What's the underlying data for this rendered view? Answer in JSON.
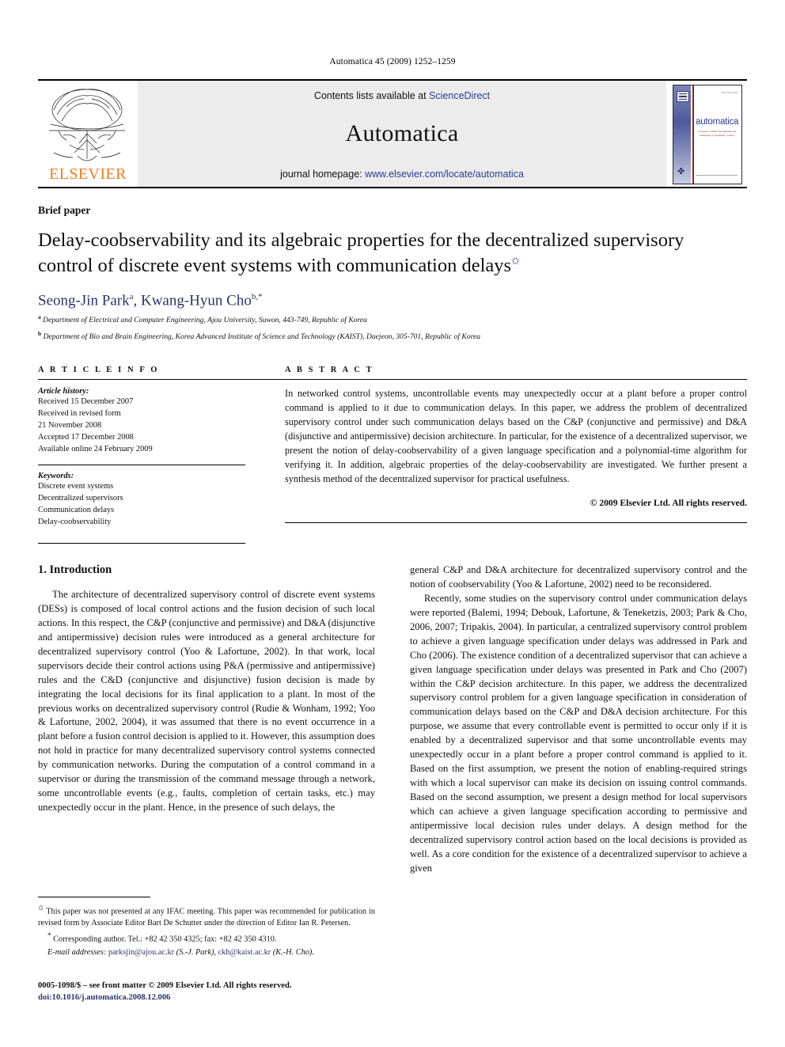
{
  "running_head": "Automatica 45 (2009) 1252–1259",
  "masthead": {
    "publisher_name": "ELSEVIER",
    "contents_prefix": "Contents lists available at ",
    "contents_link": "ScienceDirect",
    "journal_title": "Automatica",
    "homepage_prefix": "journal homepage: ",
    "homepage_url": "www.elsevier.com/locate/automatica",
    "cover": {
      "name": "automatica",
      "subtitle": "A Journal of IFAC the International Federation of Automatic Control",
      "code": "ISSN 0005-1098"
    }
  },
  "article": {
    "type": "Brief paper",
    "title": "Delay-coobservability and its algebraic properties for the decentralized supervisory control of discrete event systems with communication delays",
    "title_marker": "✩",
    "authors": "Seong-Jin Park ᵃ, Kwang-Hyun Cho ᵇ,*",
    "author_list": [
      {
        "name": "Seong-Jin Park",
        "marker": "a"
      },
      {
        "name": "Kwang-Hyun Cho",
        "marker": "b,*"
      }
    ],
    "affiliations": [
      {
        "marker": "a",
        "text": "Department of Electrical and Computer Engineering, Ajou University, Suwon, 443-749, Republic of Korea"
      },
      {
        "marker": "b",
        "text": "Department of Bio and Brain Engineering, Korea Advanced Institute of Science and Technology (KAIST), Daejeon, 305-701, Republic of Korea"
      }
    ]
  },
  "info": {
    "heading": "A R T I C L E  I N F O",
    "history_label": "Article history:",
    "history_lines": [
      "Received 15 December 2007",
      "Received in revised form",
      "21 November 2008",
      "Accepted 17 December 2008",
      "Available online 24 February 2009"
    ],
    "keywords_label": "Keywords:",
    "keywords": [
      "Discrete event systems",
      "Decentralized supervisors",
      "Communication delays",
      "Delay-coobservability"
    ]
  },
  "abstract": {
    "heading": "A B S T R A C T",
    "text": "In networked control systems, uncontrollable events may unexpectedly occur at a plant before a proper control command is applied to it due to communication delays. In this paper, we address the problem of decentralized supervisory control under such communication delays based on the C&P (conjunctive and permissive) and D&A (disjunctive and antipermissive) decision architecture. In particular, for the existence of a decentralized supervisor, we present the notion of delay-coobservability of a given language specification and a polynomial-time algorithm for verifying it. In addition, algebraic properties of the delay-coobservability are investigated. We further present a synthesis method of the decentralized supervisor for practical usefulness.",
    "copyright": "© 2009 Elsevier Ltd. All rights reserved."
  },
  "body": {
    "section_number_title": "1. Introduction",
    "left_paragraphs": [
      "The architecture of decentralized supervisory control of discrete event systems (DESs) is composed of local control actions and the fusion decision of such local actions. In this respect, the C&P (conjunctive and permissive) and D&A (disjunctive and antipermissive) decision rules were introduced as a general architecture for decentralized supervisory control (Yoo & Lafortune, 2002). In that work, local supervisors decide their control actions using P&A (permissive and antipermissive) rules and the C&D (conjunctive and disjunctive) fusion decision is made by integrating the local decisions for its final application to a plant. In most of the previous works on decentralized supervisory control (Rudie & Wonham, 1992; Yoo & Lafortune, 2002, 2004), it was assumed that there is no event occurrence in a plant before a fusion control decision is applied to it. However, this assumption does not hold in practice for many decentralized supervisory control systems connected by communication networks. During the computation of a control command in a supervisor or during the transmission of the command message through a network, some uncontrollable events (e.g., faults, completion of certain tasks, etc.) may unexpectedly occur in the plant. Hence, in the presence of such delays, the"
    ],
    "right_paragraphs": [
      "general C&P and D&A architecture for decentralized supervisory control and the notion of coobservability (Yoo & Lafortune, 2002) need to be reconsidered.",
      "Recently, some studies on the supervisory control under communication delays were reported (Balemi, 1994; Debouk, Lafortune, & Teneketzis, 2003; Park & Cho, 2006, 2007; Tripakis, 2004). In particular, a centralized supervisory control problem to achieve a given language specification under delays was addressed in Park and Cho (2006). The existence condition of a decentralized supervisor that can achieve a given language specification under delays was presented in Park and Cho (2007) within the C&P decision architecture. In this paper, we address the decentralized supervisory control problem for a given language specification in consideration of communication delays based on the C&P and D&A decision architecture. For this purpose, we assume that every controllable event is permitted to occur only if it is enabled by a decentralized supervisor and that some uncontrollable events may unexpectedly occur in a plant before a proper control command is applied to it. Based on the first assumption, we present the notion of enabling-required strings with which a local supervisor can make its decision on issuing control commands. Based on the second assumption, we present a design method for local supervisors which can achieve a given language specification according to permissive and antipermissive local decision rules under delays. A design method for the decentralized supervisory control action based on the local decisions is provided as well. As a core condition for the existence of a decentralized supervisor to achieve a given"
    ]
  },
  "footnotes": {
    "star_note": "This paper was not presented at any IFAC meeting. This paper was recommended for publication in revised form by Associate Editor Bart De Schutter under the direction of Editor Ian R. Petersen.",
    "star_mark": "✩",
    "corresponding_mark": "*",
    "corresponding": "Corresponding author. Tel.: +82 42 350 4325; fax: +82 42 350 4310.",
    "email_label": "E-mail addresses:",
    "emails": [
      {
        "address": "parksjin@ajou.ac.kr",
        "owner": "(S.-J. Park)"
      },
      {
        "address": "ckh@kaist.ac.kr",
        "owner": "(K.-H. Cho)"
      }
    ]
  },
  "imprint": {
    "line1": "0005-1098/$ – see front matter © 2009 Elsevier Ltd. All rights reserved.",
    "doi_label": "doi:",
    "doi": "10.1016/j.automatica.2008.12.006"
  },
  "colors": {
    "link": "#2b3c8f",
    "reference": "#2c3566",
    "elsevier_orange": "#f07c1b",
    "masthead_bg": "#ececec"
  }
}
